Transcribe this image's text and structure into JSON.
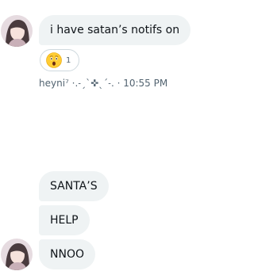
{
  "messages": {
    "first": {
      "text": "i have satan’s notifs on",
      "reaction": {
        "emoji": "😲",
        "emoji_icon": "astonished-face-icon",
        "count": "1"
      },
      "meta": "heyni⁷ ·.˗ˏˋ✜ˎˊ˗. · 10:55 PM"
    },
    "group": [
      {
        "text": "SANTA’S"
      },
      {
        "text": "HELP"
      },
      {
        "text": "NNOO"
      }
    ]
  },
  "colors": {
    "bubble_bg": "#eff3f4",
    "text": "#0f1419",
    "meta": "#536471",
    "reaction_border": "#cfd9de"
  }
}
